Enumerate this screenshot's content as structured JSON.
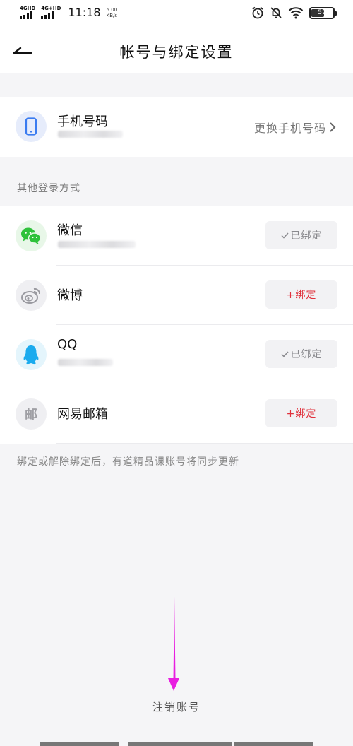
{
  "status_bar": {
    "net1": "4GHD",
    "net2": "4G+HD",
    "time": "11:18",
    "speed_value": "5.00",
    "speed_unit": "KB/s",
    "battery": "57"
  },
  "header": {
    "title": "帐号与绑定设置"
  },
  "phone": {
    "label": "手机号码",
    "change_link": "更换手机号码"
  },
  "other_login": {
    "section_label": "其他登录方式",
    "items": [
      {
        "name": "微信",
        "button": "已绑定",
        "status": "bound"
      },
      {
        "name": "微博",
        "button": "+绑定",
        "status": "unbound"
      },
      {
        "name": "QQ",
        "button": "已绑定",
        "status": "bound"
      },
      {
        "name": "网易邮箱",
        "button": "+绑定",
        "status": "unbound",
        "icon_text": "邮"
      }
    ]
  },
  "note": "绑定或解除绑定后，有道精品课账号将同步更新",
  "deactivate_label": "注销账号",
  "colors": {
    "accent_red": "#e0313c",
    "annotation_arrow": "#e81ee0",
    "wechat_green": "#2fc23b",
    "qq_blue": "#1aabee",
    "phone_blue": "#3a7bf0"
  }
}
